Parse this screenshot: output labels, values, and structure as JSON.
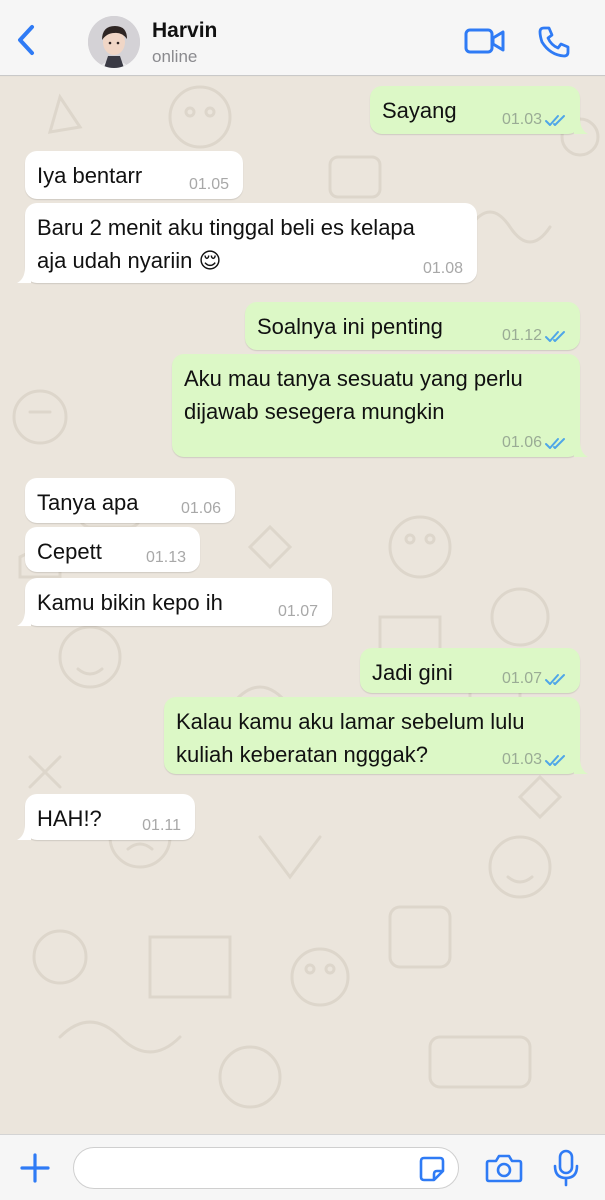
{
  "header": {
    "contact_name": "Harvin",
    "status": "online"
  },
  "icons": {
    "back": "chevron-left-icon",
    "video": "video-camera-icon",
    "call": "phone-icon",
    "plus": "plus-icon",
    "sticker": "sticker-icon",
    "camera": "camera-icon",
    "mic": "microphone-icon",
    "read": "double-check-icon"
  },
  "colors": {
    "accent": "#2f7bf5",
    "incoming_bubble": "#ffffff",
    "outgoing_bubble": "#dcf8c6",
    "read_ticks": "#4fa6e8"
  },
  "messages": [
    {
      "direction": "out",
      "text": "Sayang",
      "time": "01.03",
      "read": true
    },
    {
      "direction": "in",
      "text": "Iya bentarr",
      "time": "01.05"
    },
    {
      "direction": "in",
      "text": "Baru 2 menit aku tinggal beli es kelapa\naja udah nyariin 😌",
      "time": "01.08"
    },
    {
      "direction": "out",
      "text": "Soalnya ini penting",
      "time": "01.12",
      "read": true
    },
    {
      "direction": "out",
      "text": "Aku mau tanya sesuatu yang perlu\ndijawab sesegera mungkin",
      "time": "01.06",
      "read": true
    },
    {
      "direction": "in",
      "text": "Tanya apa",
      "time": "01.06"
    },
    {
      "direction": "in",
      "text": "Cepett",
      "time": "01.13"
    },
    {
      "direction": "in",
      "text": "Kamu bikin kepo ih",
      "time": "01.07"
    },
    {
      "direction": "out",
      "text": "Jadi gini",
      "time": "01.07",
      "read": true
    },
    {
      "direction": "out",
      "text": "Kalau kamu aku lamar sebelum lulu\nkuliah keberatan ngggak?",
      "time": "01.03",
      "read": true
    },
    {
      "direction": "in",
      "text": "HAH!?",
      "time": "01.11"
    }
  ],
  "composer": {
    "value": "",
    "placeholder": ""
  }
}
